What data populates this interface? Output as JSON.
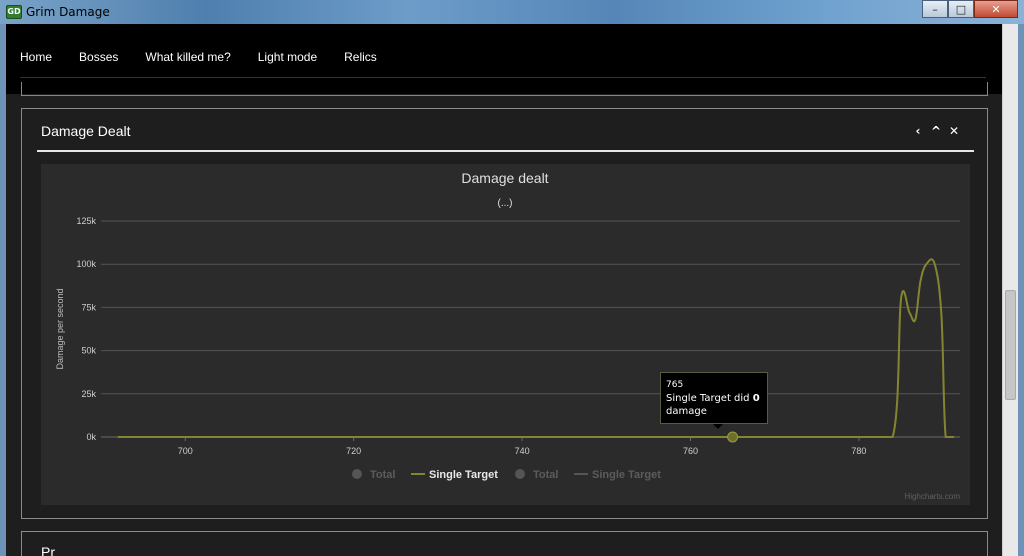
{
  "window": {
    "title": "Grim Damage",
    "icon_label": "GD",
    "minimize": "–",
    "maximize": "□",
    "close": "✕"
  },
  "nav": {
    "items": [
      {
        "label": "Home"
      },
      {
        "label": "Bosses"
      },
      {
        "label": "What killed me?"
      },
      {
        "label": "Light mode"
      },
      {
        "label": "Relics"
      }
    ]
  },
  "panel": {
    "title": "Damage Dealt",
    "tools": {
      "back": "‹",
      "collapse": "^",
      "close": "✕"
    }
  },
  "next_panel": {
    "title": "Pr"
  },
  "tooltip": {
    "x": "765",
    "line1": "Single Target did ",
    "value": "0",
    "line2": "damage"
  },
  "colors": {
    "series_single_target": "#858530",
    "background": "#2b2b2b",
    "grid": "#4a4a4a"
  },
  "chart_data": {
    "type": "line",
    "title": "Damage dealt",
    "subtitle": "(...)",
    "ylabel": "Damage per second",
    "xlabel": "",
    "xlim": [
      690,
      792
    ],
    "ylim": [
      0,
      125000
    ],
    "x_ticks": [
      "700",
      "720",
      "740",
      "760",
      "780"
    ],
    "y_ticks": [
      "0k",
      "25k",
      "50k",
      "75k",
      "100k",
      "125k"
    ],
    "grid": true,
    "legend_position": "bottom",
    "legend": [
      {
        "name": "Total",
        "visible": false,
        "marker": "circle"
      },
      {
        "name": "Single Target",
        "visible": true,
        "marker": "line"
      },
      {
        "name": "Total",
        "visible": false,
        "marker": "circle"
      },
      {
        "name": "Single Target",
        "visible": false,
        "marker": "line"
      }
    ],
    "series": [
      {
        "name": "Single Target",
        "x": [
          692,
          700,
          720,
          740,
          760,
          765,
          780,
          784,
          785,
          786,
          786.7,
          787.3,
          788,
          789,
          789.8,
          790.3,
          791.3
        ],
        "y": [
          0,
          0,
          0,
          0,
          0,
          0,
          0,
          0,
          80000,
          72000,
          68000,
          90000,
          100000,
          100000,
          70000,
          0,
          0
        ]
      }
    ],
    "highlight": {
      "x": 765,
      "y": 0
    },
    "credits": "Highcharts.com"
  }
}
